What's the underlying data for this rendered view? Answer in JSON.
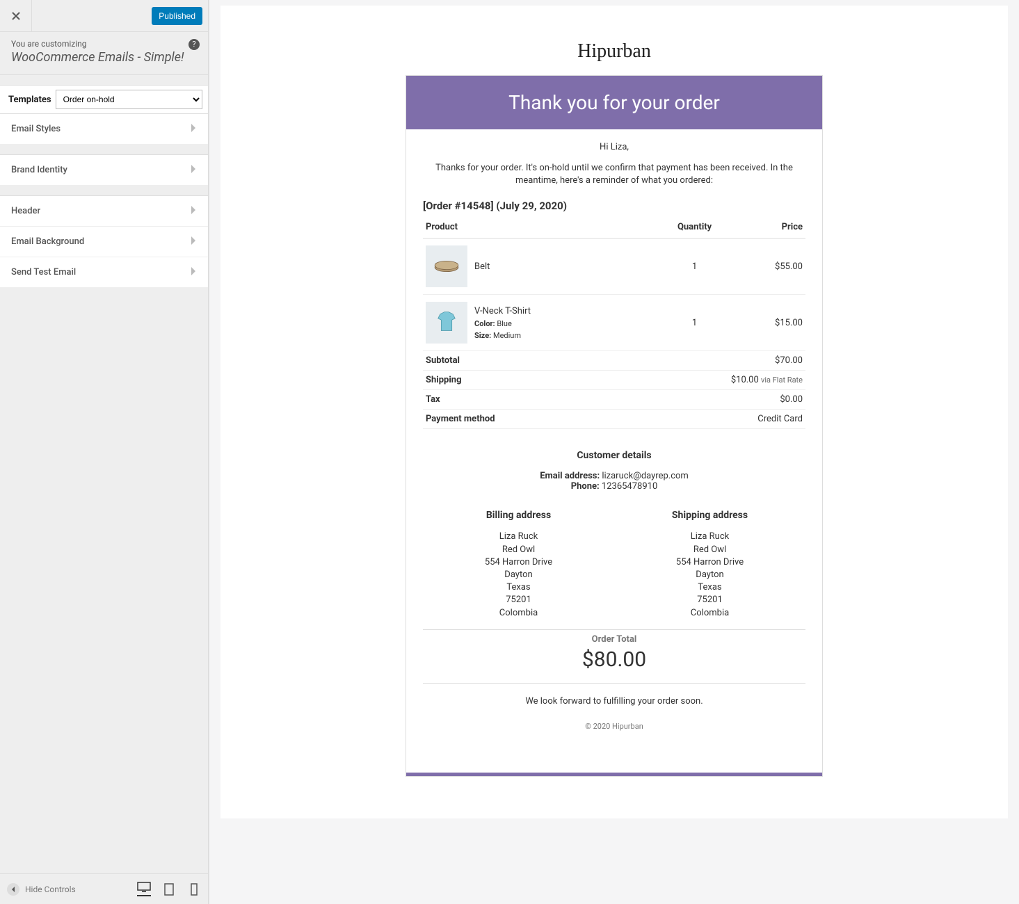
{
  "topbar": {
    "published_label": "Published"
  },
  "context": {
    "customizing_label": "You are customizing",
    "title": "WooCommerce Emails - Simple!"
  },
  "templates_label": "Templates",
  "template_selected": "Order on-hold",
  "sections": {
    "email_styles": "Email Styles",
    "brand_identity": "Brand Identity",
    "header": "Header",
    "email_background": "Email Background",
    "send_test_email": "Send Test Email"
  },
  "footer": {
    "hide_controls": "Hide Controls"
  },
  "email": {
    "brand": "Hipurban",
    "header_text": "Thank you for your order",
    "greeting": "Hi Liza,",
    "intro": "Thanks for your order. It's on-hold until we confirm that payment has been received. In the meantime, here's a reminder of what you ordered:",
    "order_number": "14548",
    "order_date": "July 29, 2020",
    "th_product": "Product",
    "th_quantity": "Quantity",
    "th_price": "Price",
    "items": [
      {
        "name": "Belt",
        "qty": "1",
        "price": "$55.00"
      },
      {
        "name": "V-Neck T-Shirt",
        "qty": "1",
        "price": "$15.00",
        "attrs": [
          {
            "k": "Color:",
            "v": "Blue"
          },
          {
            "k": "Size:",
            "v": "Medium"
          }
        ]
      }
    ],
    "subtotal_label": "Subtotal",
    "subtotal_value": "$70.00",
    "shipping_label": "Shipping",
    "shipping_value": "$10.00",
    "shipping_via": "via Flat Rate",
    "tax_label": "Tax",
    "tax_value": "$0.00",
    "payment_label": "Payment method",
    "payment_value": "Credit Card",
    "customer_details_title": "Customer details",
    "email_label": "Email address:",
    "email_value": "lizaruck@dayrep.com",
    "phone_label": "Phone:",
    "phone_value": "12365478910",
    "billing_title": "Billing address",
    "shipping_title": "Shipping address",
    "address": [
      "Liza Ruck",
      "Red Owl",
      "554 Harron Drive",
      "Dayton",
      "Texas",
      "75201",
      "Colombia"
    ],
    "order_total_label": "Order Total",
    "order_total_value": "$80.00",
    "closing": "We look forward to fulfilling your order soon.",
    "footer": "© 2020 Hipurban"
  }
}
